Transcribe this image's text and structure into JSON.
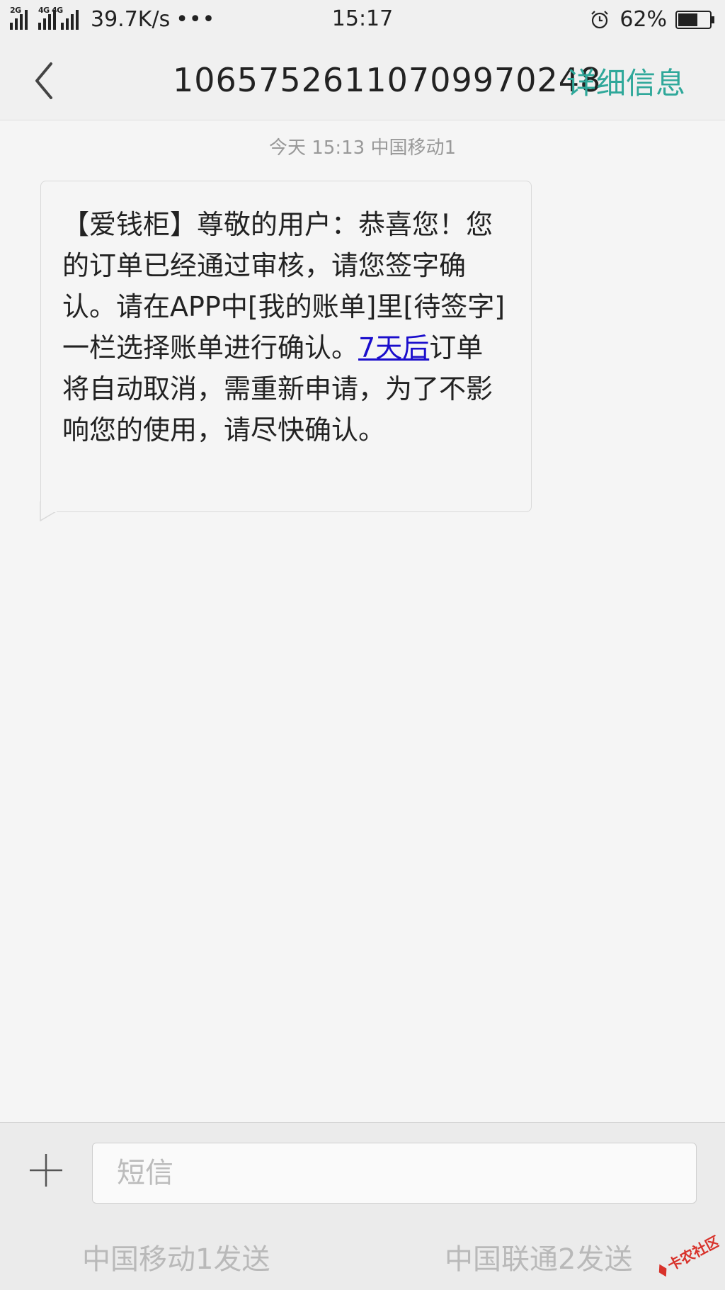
{
  "status_bar": {
    "sig1_tag": "2G",
    "sig2_tag": "4G 4G",
    "speed": "39.7K/s",
    "dots": "•••",
    "time": "15:17",
    "battery_pct": "62%",
    "battery_level": 0.62
  },
  "header": {
    "title": "1065752611070997024 8",
    "detail_label": "详细信息"
  },
  "thread": {
    "date_line": "今天 15:13 中国移动1",
    "message": {
      "part1": "【爱钱柜】尊敬的用户：恭喜您！您的订单已经通过审核，请您签字确认。请在APP中[我的账单]里[待签字]一栏选择账单进行确认。",
      "link_text": "7天后",
      "part2": "订单将自动取消，需重新申请，为了不影响您的使用，请尽快确认。"
    }
  },
  "composer": {
    "placeholder": "短信",
    "send1_label": "中国移动1发送",
    "send2_label": "中国联通2发送",
    "watermark_text": "卡农社区"
  }
}
